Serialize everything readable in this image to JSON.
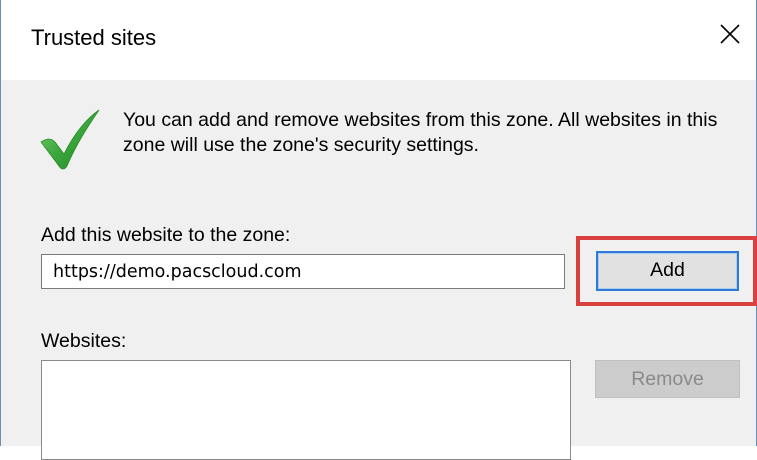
{
  "window": {
    "title": "Trusted sites",
    "close_icon": "close-icon"
  },
  "intro": {
    "icon": "checkmark-icon",
    "text": "You can add and remove websites from this zone. All websites in this zone will use the zone's security settings."
  },
  "add_site": {
    "label": "Add this website to the zone:",
    "input_value": "https://demo.pacscloud.com",
    "button_label": "Add",
    "highlight_color": "#d94040"
  },
  "websites": {
    "label": "Websites:",
    "items": [],
    "remove_label": "Remove",
    "remove_disabled": true
  },
  "colors": {
    "check_green": "#3aa83a",
    "focus_blue": "#2f7ad6"
  }
}
